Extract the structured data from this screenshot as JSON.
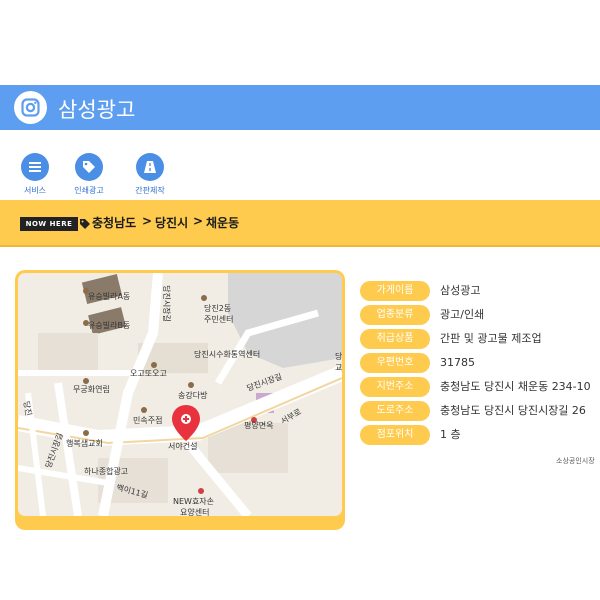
{
  "header": {
    "title": "삼성광고",
    "logo_icon": "instagram-icon"
  },
  "nav": [
    {
      "label": "서비스",
      "icon": "list-icon"
    },
    {
      "label": "인쇄광고",
      "icon": "tag-icon"
    },
    {
      "label": "간판제작",
      "icon": "road-icon"
    }
  ],
  "breadcrumb": {
    "badge": "NOW HERE",
    "items": [
      "충청남도",
      "당진시",
      "채운동"
    ],
    "separator": ">"
  },
  "map": {
    "labels": {
      "yusung_a": "유승빌라A동",
      "yusung_b": "유승빌라B동",
      "dangjin2": "당진2동",
      "community": "주민센터",
      "ogtto": "오고또오고",
      "mugung": "무궁화연립",
      "songgang": "송강다방",
      "minsok": "민속주점",
      "haengbok": "행복샘교회",
      "hana": "하나종합광고",
      "seoya": "서야건설",
      "pyeongyang": "평양면옥",
      "newhyo": "NEW효자손",
      "yoyang": "요양센터",
      "hwatong": "당진시수화통역센터",
      "sijang_ro": "당진시장길",
      "sijang_ro2": "당진시장길",
      "sijang_ro3": "당진시장길",
      "seobu": "서부로",
      "dangjin_ro": "당진",
      "baekdu": "백이11길",
      "partial_right": "당\n교"
    }
  },
  "info": [
    {
      "key": "가게이름",
      "value": "삼성광고"
    },
    {
      "key": "업종분류",
      "value": "광고/인쇄"
    },
    {
      "key": "취급상품",
      "value": "간판 및 광고물 제조업"
    },
    {
      "key": "우편번호",
      "value": "31785"
    },
    {
      "key": "지번주소",
      "value": "충청남도 당진시 채운동 234-10"
    },
    {
      "key": "도로주소",
      "value": "충청남도 당진시 당진시장길 26"
    },
    {
      "key": "점포위치",
      "value": "1 층"
    }
  ],
  "source": "소상공인시장",
  "colors": {
    "header_blue": "#5e9ef0",
    "accent_yellow": "#ffcb4f",
    "nav_blue": "#4a8ee6",
    "marker_red": "#e8333f"
  }
}
